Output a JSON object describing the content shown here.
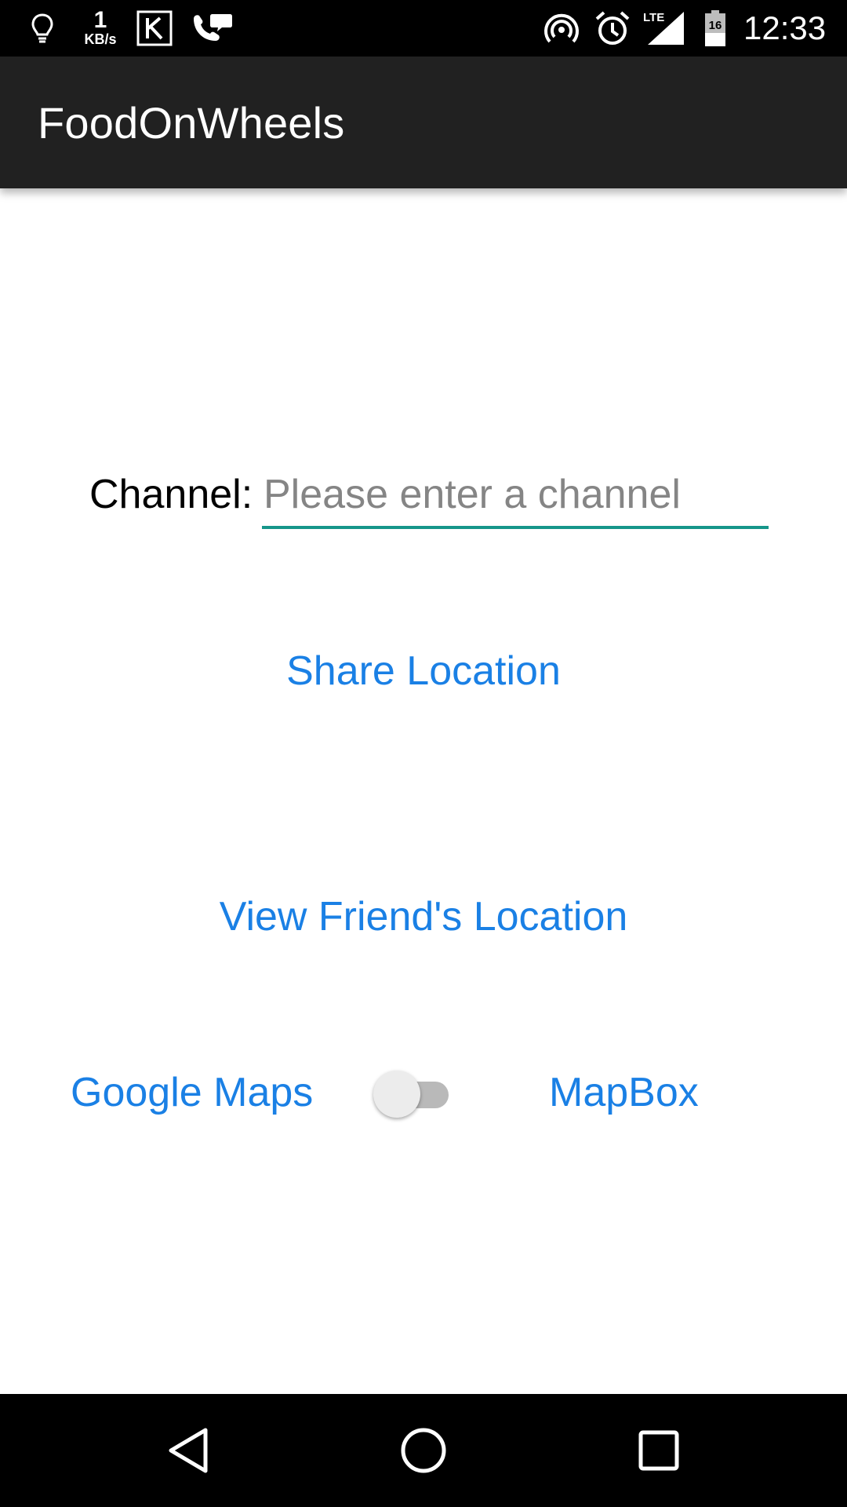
{
  "status_bar": {
    "network_speed_value": "1",
    "network_speed_unit": "KB/s",
    "battery_level": "16",
    "time": "12:33",
    "network_type": "LTE",
    "icons": [
      "lightbulb-icon",
      "keeper-k-icon",
      "phone-chat-icon",
      "hotspot-icon",
      "alarm-icon",
      "signal-icon",
      "battery-icon"
    ]
  },
  "app_bar": {
    "title": "FoodOnWheels"
  },
  "channel": {
    "label": "Channel:",
    "value": "",
    "placeholder": "Please enter a channel",
    "underline_color": "#16968a"
  },
  "actions": {
    "share_location": "Share Location",
    "view_friend_location": "View Friend's Location"
  },
  "map_provider": {
    "left_label": "Google Maps",
    "right_label": "MapBox",
    "switch_on": false
  },
  "colors": {
    "accent_text": "#1a80e5",
    "app_bar": "#212121",
    "status_bar": "#000000"
  },
  "nav_bar": {
    "icons": [
      "back-icon",
      "home-icon",
      "recents-icon"
    ]
  }
}
